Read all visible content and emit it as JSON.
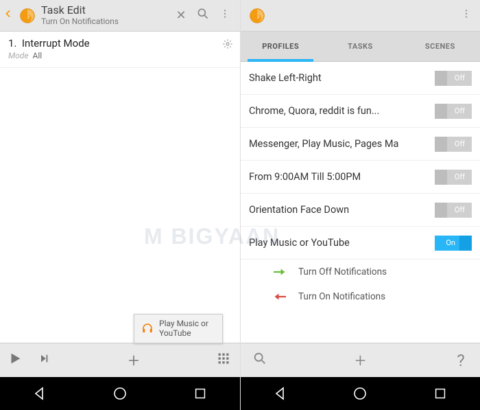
{
  "left": {
    "appbar": {
      "title": "Task Edit",
      "subtitle": "Turn On Notifications"
    },
    "action": {
      "index": "1.",
      "name": "Interrupt Mode",
      "mode_label": "Mode",
      "mode_value": "All"
    },
    "tooltip": {
      "text": "Play Music or YouTube"
    }
  },
  "right": {
    "tabs": {
      "profiles": "PROFILES",
      "tasks": "TASKS",
      "scenes": "SCENES"
    },
    "profiles": [
      {
        "label": "Shake Left-Right",
        "state": "off",
        "state_label": "Off"
      },
      {
        "label": "Chrome, Quora, reddit is fun...",
        "state": "off",
        "state_label": "Off"
      },
      {
        "label": "Messenger, Play Music, Pages Ma",
        "state": "off",
        "state_label": "Off"
      },
      {
        "label": "From  9:00AM Till  5:00PM",
        "state": "off",
        "state_label": "Off"
      },
      {
        "label": "Orientation Face Down",
        "state": "off",
        "state_label": "Off"
      },
      {
        "label": "Play Music or YouTube",
        "state": "on",
        "state_label": "On"
      }
    ],
    "expanded": {
      "off_task": "Turn Off Notifications",
      "on_task": "Turn On Notifications"
    }
  },
  "watermark": "M  BIGYAAN"
}
